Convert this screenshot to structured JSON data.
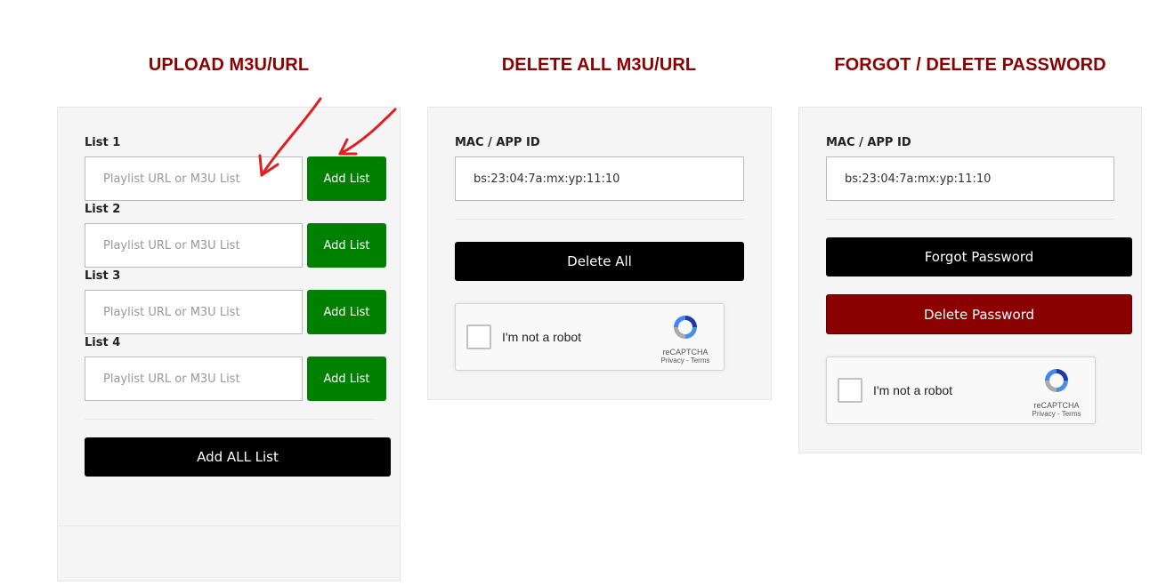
{
  "columns": {
    "upload": {
      "title": "UPLOAD M3U/URL",
      "lists": [
        {
          "label": "List 1",
          "placeholder": "Playlist URL or M3U List",
          "value": "",
          "button": "Add List"
        },
        {
          "label": "List 2",
          "placeholder": "Playlist URL or M3U List",
          "value": "",
          "button": "Add List"
        },
        {
          "label": "List 3",
          "placeholder": "Playlist URL or M3U List",
          "value": "",
          "button": "Add List"
        },
        {
          "label": "List 4",
          "placeholder": "Playlist URL or M3U List",
          "value": "",
          "button": "Add List"
        }
      ],
      "add_all_label": "Add ALL List"
    },
    "delete_all": {
      "title": "DELETE ALL M3U/URL",
      "mac_label": "MAC / APP ID",
      "mac_value": "bs:23:04:7a:mx:yp:11:10",
      "delete_all_label": "Delete All",
      "captcha": {
        "text": "I'm not a robot",
        "brand": "reCAPTCHA",
        "links": "Privacy - Terms",
        "checked": false
      }
    },
    "password": {
      "title": "FORGOT / DELETE PASSWORD",
      "mac_label": "MAC / APP ID",
      "mac_value": "bs:23:04:7a:mx:yp:11:10",
      "forgot_label": "Forgot Password",
      "delete_label": "Delete Password",
      "captcha": {
        "text": "I'm not a robot",
        "brand": "reCAPTCHA",
        "links": "Privacy - Terms",
        "checked": false
      }
    }
  },
  "colors": {
    "title": "#8b0000",
    "add_button": "#008000",
    "primary_button": "#000000",
    "danger_button": "#8b0000",
    "annotation_arrow": "#e02020"
  }
}
